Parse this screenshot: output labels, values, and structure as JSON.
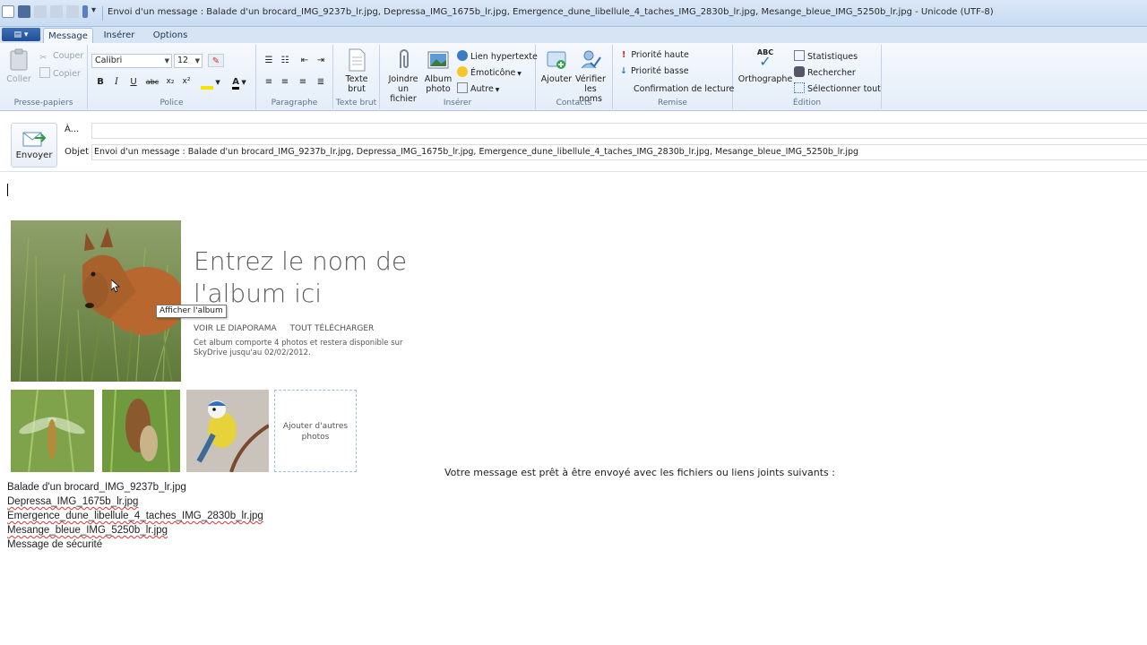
{
  "window": {
    "title": "Envoi d'un message : Balade d'un brocard_IMG_9237b_lr.jpg, Depressa_IMG_1675b_lr.jpg, Emergence_dune_libellule_4_taches_IMG_2830b_lr.jpg, Mesange_bleue_IMG_5250b_lr.jpg - Unicode (UTF-8)"
  },
  "tabs": [
    {
      "label": "Message",
      "active": true
    },
    {
      "label": "Insérer",
      "active": false
    },
    {
      "label": "Options",
      "active": false
    }
  ],
  "ribbon": {
    "clipboard": {
      "paste": "Coller",
      "cut": "Couper",
      "copy": "Copier",
      "label": "Presse-papiers"
    },
    "font": {
      "family": "Calibri",
      "size": "12",
      "label": "Police",
      "bold": "B",
      "italic": "I",
      "underline": "U",
      "strike": "abc",
      "subscript": "x₂",
      "superscript": "x²",
      "color": "A"
    },
    "paragraph": {
      "label": "Paragraphe"
    },
    "plaintext": {
      "button": [
        "Texte",
        "brut"
      ],
      "label": "Texte brut"
    },
    "insert": {
      "attach": [
        "Joindre",
        "un fichier"
      ],
      "album": [
        "Album",
        "photo"
      ],
      "hyperlink": "Lien hypertexte",
      "emoticon": "Émoticône",
      "other": "Autre",
      "label": "Insérer"
    },
    "contacts": {
      "add": "Ajouter",
      "check": [
        "Vérifier",
        "les noms"
      ],
      "label": "Contacts"
    },
    "delivery": {
      "high": "Priorité haute",
      "low": "Priorité basse",
      "receipt": "Confirmation de lecture",
      "label": "Remise"
    },
    "editing": {
      "spelling": "Orthographe",
      "spelling_icon_text": "ABC",
      "stats": "Statistiques",
      "find": "Rechercher",
      "select_all": "Sélectionner tout",
      "label": "Édition"
    }
  },
  "compose": {
    "send": "Envoyer",
    "to_label": "À...",
    "to_value": "",
    "subject_label": "Objet",
    "subject_value": "Envoi d'un message : Balade d'un brocard_IMG_9237b_lr.jpg, Depressa_IMG_1675b_lr.jpg, Emergence_dune_libellule_4_taches_IMG_2830b_lr.jpg, Mesange_bleue_IMG_5250b_lr.jpg"
  },
  "body": {
    "album_title": "Entrez le nom de l'album ici",
    "tooltip": "Afficher l'album",
    "slideshow": "VOIR LE DIAPORAMA",
    "download_all": "TOUT TÉLÉCHARGER",
    "album_info": "Cet album comporte 4 photos et restera disponible sur SkyDrive jusqu'au 02/02/2012.",
    "add_more": "Ajouter d'autres photos",
    "ready_message": "Votre message est prêt à être envoyé avec les fichiers ou liens joints suivants :",
    "files": [
      "Balade d'un brocard_IMG_9237b_lr.jpg",
      "Depressa_IMG_1675b_lr.jpg",
      "Emergence_dune_libellule_4_taches_IMG_2830b_lr.jpg",
      "Mesange_bleue_IMG_5250b_lr.jpg",
      "Message de sécurité"
    ]
  }
}
